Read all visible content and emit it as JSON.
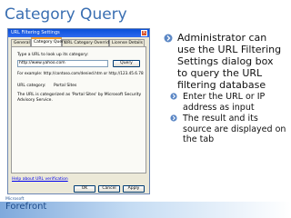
{
  "slide": {
    "title": "Category Query"
  },
  "dialog": {
    "title": "URL Filtering Settings",
    "tabs": [
      "General",
      "Category Query",
      "URL Category Override",
      "License Details"
    ],
    "prompt_label": "Type a URL to look up its category:",
    "url_value": "http://www.yahoo.com",
    "query_button": "Query",
    "example_text": "For example: http://contoso.com/denied.htm or http://123.45.6.78",
    "category_label": "URL category:",
    "category_value": "Portal Sites",
    "result_text_line1": "The URL is categorized as 'Portal Sites' by Microsoft Security",
    "result_text_line2": "Advisory Service.",
    "help_link": "Help about URL verification",
    "buttons": {
      "ok": "OK",
      "cancel": "Cancel",
      "apply": "Apply"
    }
  },
  "bullets": {
    "main": "Administrator can use the URL Filtering Settings dialog box to query the URL filtering database",
    "sub": [
      "Enter the URL or IP address as input",
      "The result and its source are displayed on the tab"
    ]
  },
  "footer": {
    "logo_small": "Microsoft",
    "logo_word": "Forefront"
  },
  "colors": {
    "title": "#3a6fb2",
    "bullet": "#5b87c5",
    "titlebar": "#0a4fd8"
  }
}
